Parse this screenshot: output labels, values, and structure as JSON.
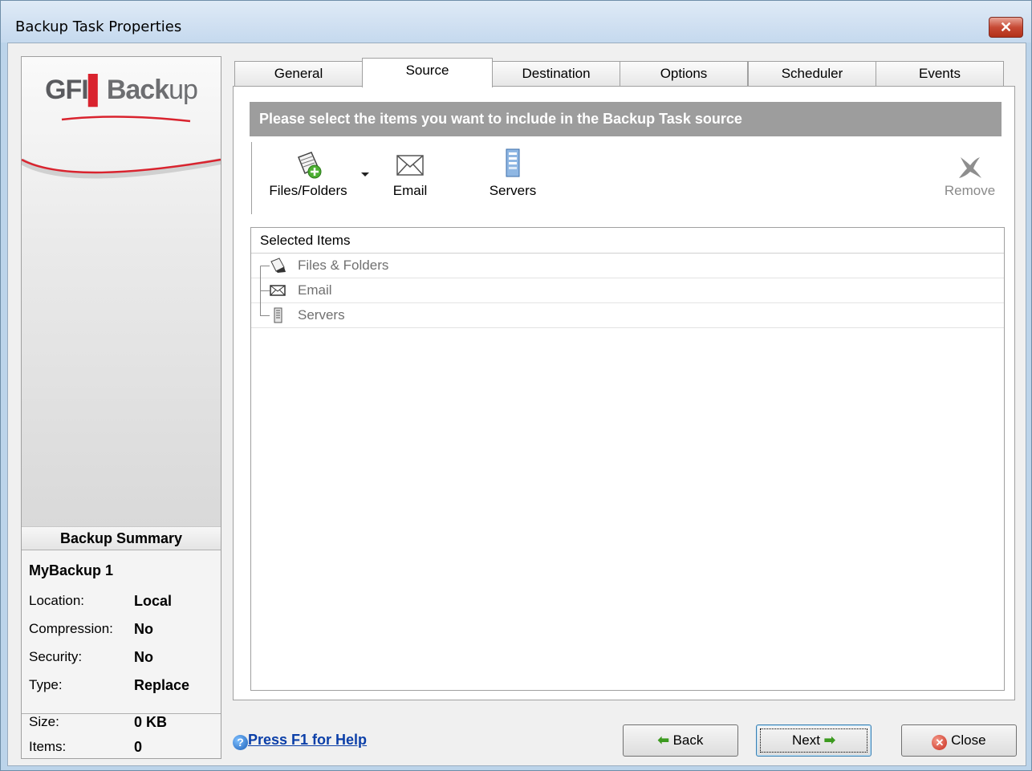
{
  "window": {
    "title": "Backup Task Properties",
    "close_glyph": "✕"
  },
  "sidebar": {
    "logo": {
      "gfi": "GFI",
      "bar": "▌",
      "back": "Back",
      "up": "up"
    },
    "summary_title": "Backup Summary",
    "task_name": "MyBackup 1",
    "rows": [
      {
        "label": "Location:",
        "value": "Local"
      },
      {
        "label": "Compression:",
        "value": "No"
      },
      {
        "label": "Security:",
        "value": "No"
      },
      {
        "label": "Type:",
        "value": "Replace"
      }
    ],
    "stats": [
      {
        "label": "Size:",
        "value": "0 KB"
      },
      {
        "label": "Items:",
        "value": "0"
      }
    ]
  },
  "tabs": [
    "General",
    "Source",
    "Destination",
    "Options",
    "Scheduler",
    "Events"
  ],
  "active_tab": "Source",
  "source": {
    "banner": "Please select the items you want to include in the Backup Task source",
    "toolbar": {
      "files_folders": "Files/Folders",
      "email": "Email",
      "servers": "Servers",
      "remove": "Remove"
    },
    "list_header": "Selected Items",
    "items": [
      "Files & Folders",
      "Email",
      "Servers"
    ]
  },
  "footer": {
    "help_glyph": "?",
    "help": "Press F1 for Help",
    "back": "Back",
    "next": "Next",
    "close": "Close",
    "back_arrow": "⬅",
    "next_arrow": "➡",
    "close_glyph": "✕"
  },
  "colors": {
    "banner": "#9d9d9d",
    "link": "#0b3fa8",
    "accent_red": "#d9232e",
    "title_gradient_top": "#dfeaf6"
  }
}
